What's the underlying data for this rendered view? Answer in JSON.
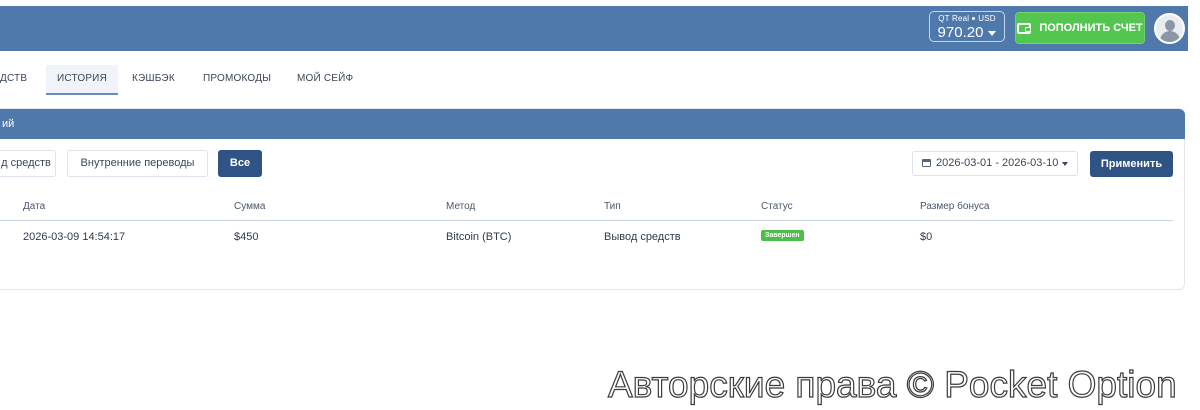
{
  "header": {
    "account_type": "QT Real",
    "currency": "USD",
    "balance": "970.20",
    "deposit_label": "пополнить счет"
  },
  "tabs": [
    {
      "label": "дств",
      "active": false
    },
    {
      "label": "история",
      "active": true
    },
    {
      "label": "кэшбэк",
      "active": false
    },
    {
      "label": "промокоды",
      "active": false
    },
    {
      "label": "мой сейф",
      "active": false
    }
  ],
  "panel": {
    "title": "ий",
    "filters": [
      {
        "label": "д средств",
        "active": false
      },
      {
        "label": "Внутренние переводы",
        "active": false
      },
      {
        "label": "Все",
        "active": true
      }
    ],
    "date_range": "2026-03-01 - 2026-03-10",
    "apply_label": "Применить"
  },
  "table": {
    "columns": [
      "Дата",
      "Сумма",
      "Метод",
      "Тип",
      "Статус",
      "Размер бонуса"
    ],
    "rows": [
      {
        "date": "2026-03-09 14:54:17",
        "amount": "$450",
        "method": "Bitcoin (BTC)",
        "type": "Вывод средств",
        "status": "Завершен",
        "bonus": "$0"
      }
    ]
  },
  "watermark": "Авторские права © Pocket Option",
  "colors": {
    "header_bg": "#4f79aa",
    "deposit_green": "#52c64e",
    "primary_button": "#2f5385",
    "status_green": "#4bbf4a"
  }
}
